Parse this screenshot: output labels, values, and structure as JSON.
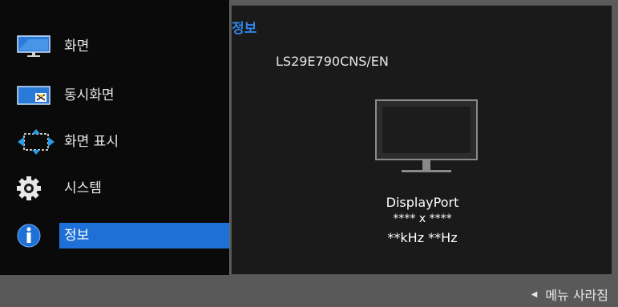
{
  "menu": {
    "items": [
      {
        "label": "화면",
        "icon": "monitor-icon"
      },
      {
        "label": "동시화면",
        "icon": "pip-icon"
      },
      {
        "label": "화면 표시",
        "icon": "display-arrows-icon"
      },
      {
        "label": "시스템",
        "icon": "gear-icon"
      },
      {
        "label": "정보",
        "icon": "info-icon"
      }
    ],
    "selected_index": 4
  },
  "panel": {
    "title": "정보",
    "model": "LS29E790CNS/EN",
    "input_source": "DisplayPort",
    "resolution": "**** x ****",
    "frequency": "**kHz **Hz"
  },
  "footer": {
    "hint": "메뉴 사라짐"
  },
  "colors": {
    "accent": "#2f86e8",
    "selection": "#1e6fd6",
    "menu_bg": "#0a0a0a",
    "panel_bg": "#1a1a1a"
  }
}
